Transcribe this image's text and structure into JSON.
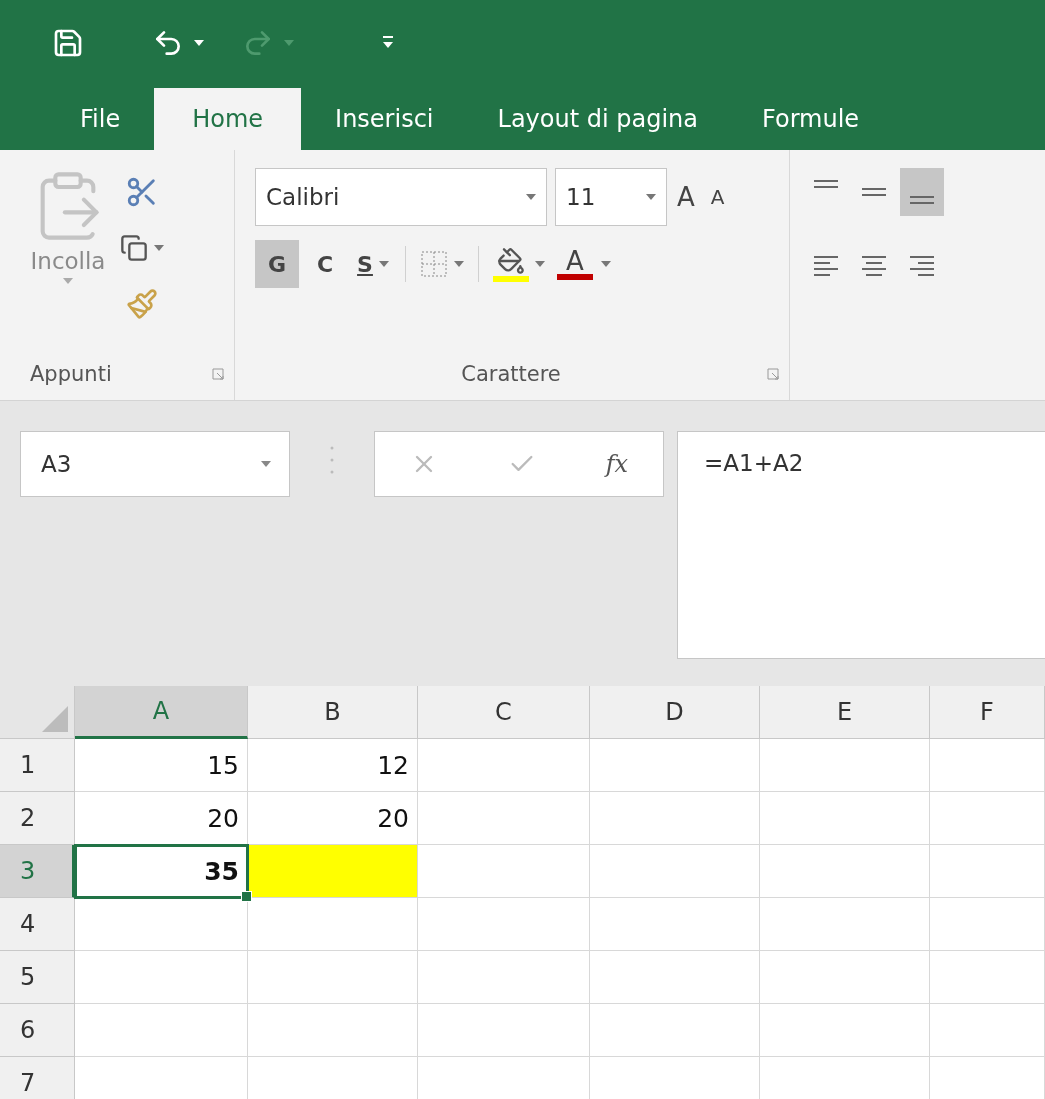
{
  "quick_access": [
    {
      "kind": "save",
      "disabled": false
    },
    {
      "kind": "undo",
      "disabled": false
    },
    {
      "kind": "redo",
      "disabled": true
    },
    {
      "kind": "customize",
      "disabled": false
    }
  ],
  "tabs": [
    {
      "label": "File",
      "selected": false
    },
    {
      "label": "Home",
      "selected": true
    },
    {
      "label": "Inserisci",
      "selected": false
    },
    {
      "label": "Layout di pagina",
      "selected": false
    },
    {
      "label": "Formule",
      "selected": false
    }
  ],
  "ribbon": {
    "clipboard": {
      "paste_label": "Incolla",
      "group_label": "Appunti"
    },
    "font": {
      "name": "Calibri",
      "size": "11",
      "grow": "A",
      "shrink": "A",
      "styles": [
        {
          "label": "G",
          "kind": "bold",
          "pressed": true
        },
        {
          "label": "C",
          "kind": "italic",
          "pressed": false
        },
        {
          "label": "S",
          "kind": "underline",
          "pressed": false
        }
      ],
      "font_color_label": "A",
      "group_label": "Carattere"
    },
    "alignment": {
      "vertical": [
        {
          "kind": "top",
          "pressed": false
        },
        {
          "kind": "middle",
          "pressed": false
        },
        {
          "kind": "bottom",
          "pressed": true
        }
      ],
      "horizontal": [
        {
          "kind": "left",
          "pressed": false
        },
        {
          "kind": "center",
          "pressed": false
        },
        {
          "kind": "right",
          "pressed": false
        }
      ]
    }
  },
  "formula_bar": {
    "name_box": "A3",
    "function_label": "fx",
    "formula": "=A1+A2"
  },
  "sheet": {
    "columns": [
      {
        "label": "A",
        "selected": true
      },
      {
        "label": "B",
        "selected": false
      },
      {
        "label": "C",
        "selected": false
      },
      {
        "label": "D",
        "selected": false
      },
      {
        "label": "E",
        "selected": false
      },
      {
        "label": "F",
        "selected": false
      }
    ],
    "rows": [
      {
        "label": "1",
        "selected": false,
        "cells": [
          {
            "value": "15",
            "bold": false,
            "selected": false
          },
          {
            "value": "12",
            "bold": false,
            "selected": false
          }
        ]
      },
      {
        "label": "2",
        "selected": false,
        "cells": [
          {
            "value": "20",
            "bold": false,
            "selected": false
          },
          {
            "value": "20",
            "bold": false,
            "selected": false
          }
        ]
      },
      {
        "label": "3",
        "selected": true,
        "cells": [
          {
            "value": "35",
            "bold": true,
            "selected": true
          },
          {
            "color": "#ffff00",
            "selected": false
          }
        ]
      },
      {
        "label": "4",
        "selected": false,
        "cells": []
      },
      {
        "label": "5",
        "selected": false,
        "cells": []
      },
      {
        "label": "6",
        "selected": false,
        "cells": []
      },
      {
        "label": "7",
        "selected": false,
        "cells": []
      }
    ]
  }
}
